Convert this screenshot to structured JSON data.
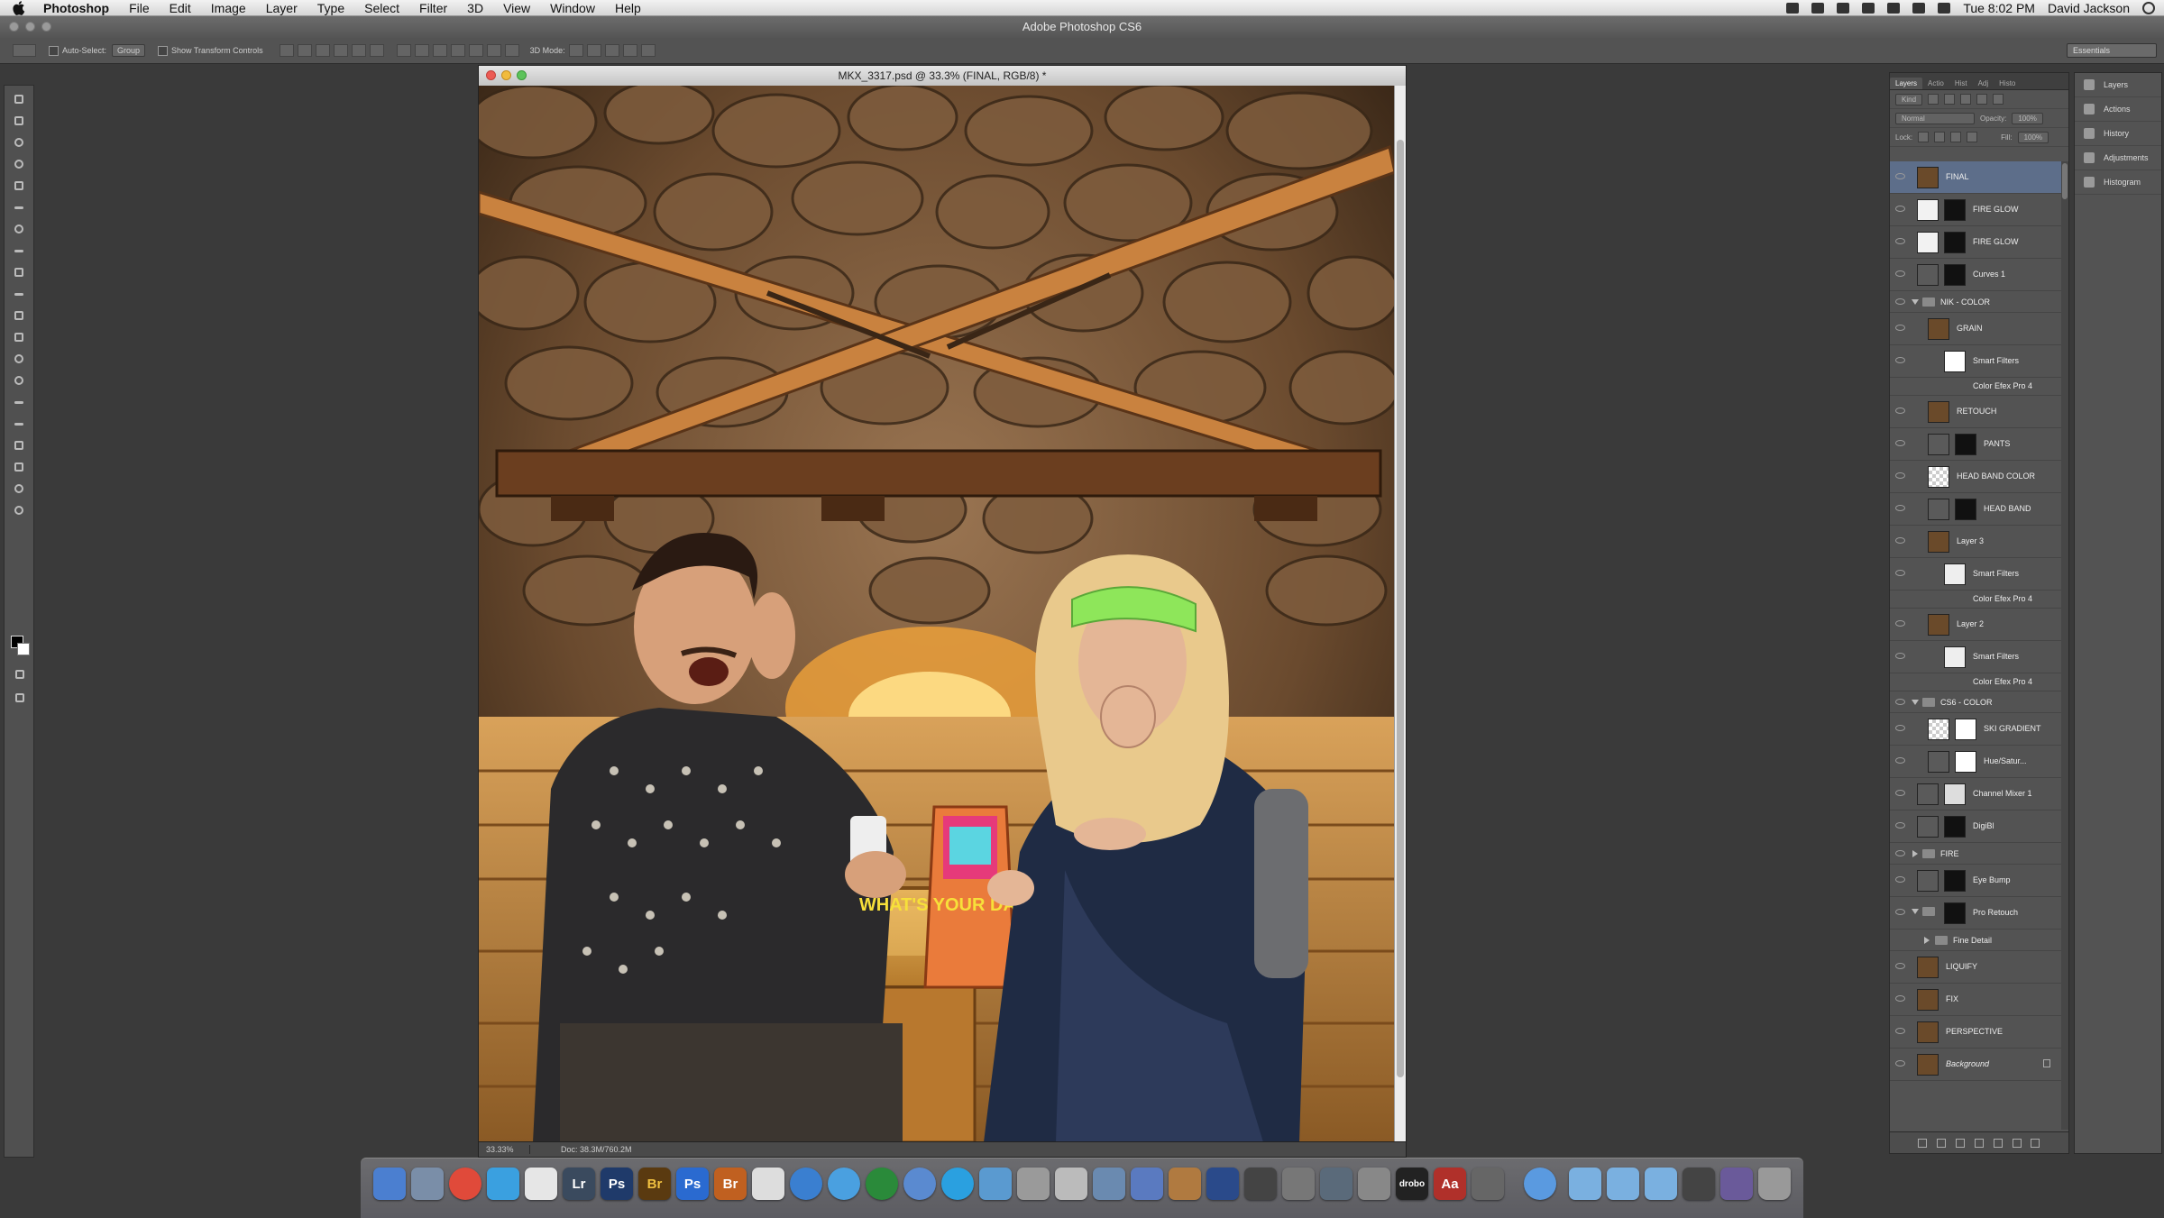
{
  "menubar": {
    "app": "Photoshop",
    "items": [
      "File",
      "Edit",
      "Image",
      "Layer",
      "Type",
      "Select",
      "Filter",
      "3D",
      "View",
      "Window",
      "Help"
    ],
    "clock": "Tue 8:02 PM",
    "user": "David Jackson"
  },
  "titlebar": {
    "title": "Adobe Photoshop CS6"
  },
  "options": {
    "auto_select": "Auto-Select:",
    "auto_select_value": "Group",
    "transform": "Show Transform Controls",
    "mode3d": "3D Mode:",
    "workspace": "Essentials"
  },
  "document": {
    "title": "MKX_3317.psd @ 33.3% (FINAL, RGB/8) *",
    "zoom": "33.33%",
    "doc_info": "Doc: 38.3M/760.2M"
  },
  "layers_panel": {
    "tabs": [
      "Layers",
      "Actio",
      "Hist",
      "Adj",
      "Histo"
    ],
    "kind": "Kind",
    "blend": "Normal",
    "opacity_label": "Opacity:",
    "opacity": "100%",
    "lock_label": "Lock:",
    "fill_label": "Fill:",
    "fill": "100%",
    "layers": [
      {
        "name": "FINAL"
      },
      {
        "name": "FIRE GLOW"
      },
      {
        "name": "FIRE GLOW"
      },
      {
        "name": "Curves 1"
      },
      {
        "name": "NIK - COLOR"
      },
      {
        "name": "GRAIN"
      },
      {
        "name": "Smart Filters"
      },
      {
        "name": "Color Efex Pro 4"
      },
      {
        "name": "RETOUCH"
      },
      {
        "name": "PANTS"
      },
      {
        "name": "HEAD BAND COLOR"
      },
      {
        "name": "HEAD BAND"
      },
      {
        "name": "Layer 3"
      },
      {
        "name": "Smart Filters"
      },
      {
        "name": "Color Efex Pro 4"
      },
      {
        "name": "Layer 2"
      },
      {
        "name": "Smart Filters"
      },
      {
        "name": "Color Efex Pro 4"
      },
      {
        "name": "CS6 - COLOR"
      },
      {
        "name": "SKI GRADIENT"
      },
      {
        "name": "Hue/Satur..."
      },
      {
        "name": "Channel Mixer 1"
      },
      {
        "name": "DigiBl"
      },
      {
        "name": "FIRE"
      },
      {
        "name": "Eye Bump"
      },
      {
        "name": "Pro Retouch"
      },
      {
        "name": "Fine Detail"
      },
      {
        "name": "LIQUIFY"
      },
      {
        "name": "FIX"
      },
      {
        "name": "PERSPECTIVE"
      },
      {
        "name": "Background"
      }
    ]
  },
  "side_panels": [
    "Layers",
    "Actions",
    "History",
    "Adjustments",
    "Histogram"
  ],
  "photo": {
    "bag_text": "WHAT'S YOUR DAMAGE?"
  },
  "dock": {
    "labels": {
      "lr": "Lr",
      "ps": "Ps",
      "br": "Br",
      "ps2": "Ps",
      "br2": "Br",
      "drobo": "drobo",
      "aa": "Aa"
    }
  },
  "colors": {
    "accent": "#5d6e8a",
    "panel": "#535353",
    "background": "#3a3a3a"
  }
}
